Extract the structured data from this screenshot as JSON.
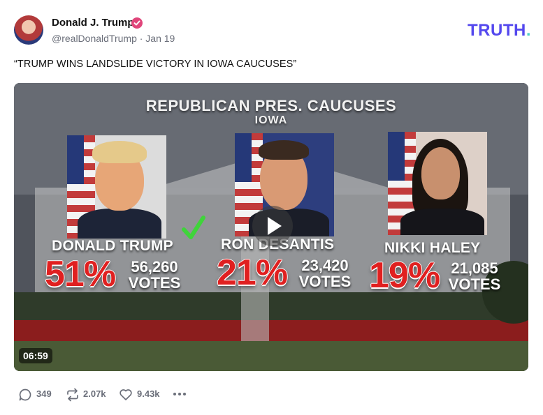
{
  "post": {
    "author_name": "Donald J. Trump",
    "handle_date": "@realDonaldTrump · Jan 19",
    "text": "“TRUMP WINS LANDSLIDE VICTORY IN IOWA CAUCUSES”",
    "brand": {
      "main": "TRUTH",
      "dot": "."
    },
    "accent_color": "#5448ee",
    "verified_color": "#e0457a"
  },
  "video": {
    "headline": "REPUBLICAN PRES. CAUCUSES",
    "subhead": "IOWA",
    "duration": "06:59",
    "candidates": [
      {
        "name": "DONALD TRUMP",
        "percent": "51%",
        "votes": "56,260",
        "votes_label": "VOTES",
        "winner": true
      },
      {
        "name": "RON DESANTIS",
        "percent": "21%",
        "votes": "23,420",
        "votes_label": "VOTES",
        "winner": false
      },
      {
        "name": "NIKKI HALEY",
        "percent": "19%",
        "votes": "21,085",
        "votes_label": "VOTES",
        "winner": false
      }
    ]
  },
  "actions": {
    "replies": "349",
    "retruths": "2.07k",
    "likes": "9.43k"
  },
  "icons": [
    "reply-icon",
    "retruth-icon",
    "like-icon",
    "more-icon",
    "verified-icon",
    "play-icon",
    "check-icon"
  ]
}
